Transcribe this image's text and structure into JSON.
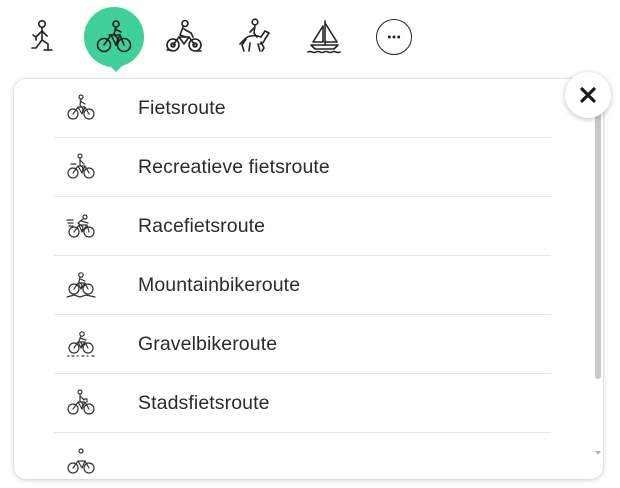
{
  "activities": [
    {
      "icon": "hiker-icon",
      "active": false
    },
    {
      "icon": "cyclist-icon",
      "active": true
    },
    {
      "icon": "motorbike-icon",
      "active": false
    },
    {
      "icon": "horse-rider-icon",
      "active": false
    },
    {
      "icon": "sailboat-icon",
      "active": false
    },
    {
      "icon": "more-icon",
      "active": false
    }
  ],
  "colors": {
    "accent": "#3fcf9a"
  },
  "routes": [
    {
      "label": "Fietsroute",
      "icon": "bike-icon"
    },
    {
      "label": "Recreatieve fietsroute",
      "icon": "recreational-bike-icon"
    },
    {
      "label": "Racefietsroute",
      "icon": "racebike-icon"
    },
    {
      "label": "Mountainbikeroute",
      "icon": "mountainbike-icon"
    },
    {
      "label": "Gravelbikeroute",
      "icon": "gravelbike-icon"
    },
    {
      "label": "Stadsfietsroute",
      "icon": "citybike-icon"
    },
    {
      "label": "",
      "icon": "bike-icon"
    }
  ],
  "close": {
    "icon": "close-icon"
  }
}
